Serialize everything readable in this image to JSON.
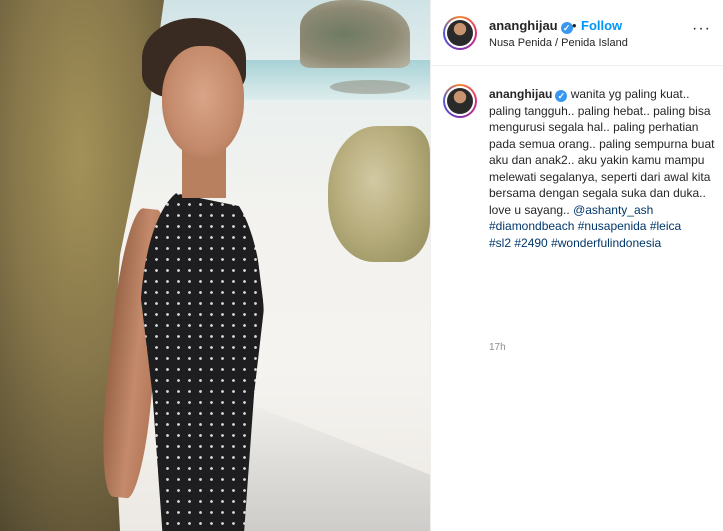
{
  "post": {
    "username": "ananghijau",
    "verified_symbol": "✓",
    "separator": "•",
    "follow_label": "Follow",
    "location": "Nusa Penida / Penida Island",
    "more_label": "···"
  },
  "caption": {
    "username": "ananghijau",
    "text": "wanita yg paling kuat.. paling tangguh.. paling hebat.. paling bisa mengurusi segala hal.. paling perhatian pada semua orang.. paling sempurna buat aku dan anak2.. aku yakin kamu mampu melewati segalanya, seperti dari awal kita bersama dengan segala suka dan duka.. love u sayang.. ",
    "mention": "@ashanty_ash",
    "hashtags": [
      "#diamondbeach",
      "#nusapenida",
      "#leica",
      "#sl2",
      "#2490",
      "#wonderfulindonesia"
    ],
    "timestamp": "17h"
  },
  "photo": {
    "alt": "Woman in black polka-dot outfit leaning against a rock cliff on a beach"
  }
}
